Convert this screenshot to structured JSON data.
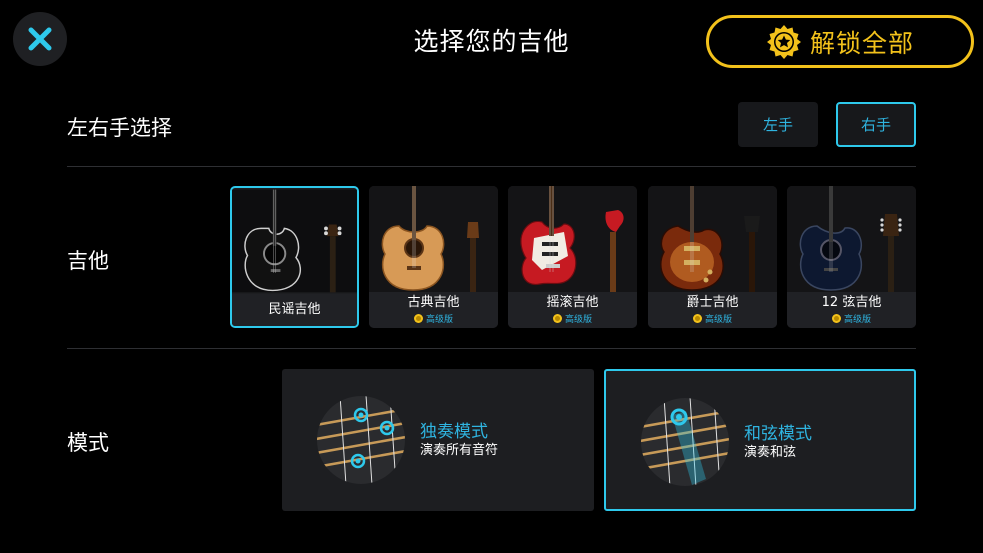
{
  "header": {
    "title": "选择您的吉他",
    "close_icon": "close-icon",
    "unlock_label": "解锁全部",
    "unlock_icon": "star-badge-icon",
    "accent_yellow": "#f3c21b",
    "accent_cyan": "#2ec9ec"
  },
  "handedness": {
    "label": "左右手选择",
    "options": [
      "左手",
      "右手"
    ],
    "selected": "右手"
  },
  "guitars": {
    "label": "吉他",
    "items": [
      {
        "name": "民谣吉他",
        "premium": "",
        "selected": true
      },
      {
        "name": "古典吉他",
        "premium": "高级版",
        "selected": false
      },
      {
        "name": "摇滚吉他",
        "premium": "高级版",
        "selected": false
      },
      {
        "name": "爵士吉他",
        "premium": "高级版",
        "selected": false
      },
      {
        "name": "12 弦吉他",
        "premium": "高级版",
        "selected": false
      }
    ]
  },
  "mode": {
    "label": "模式",
    "items": [
      {
        "title": "独奏模式",
        "subtitle": "演奏所有音符",
        "selected": false
      },
      {
        "title": "和弦模式",
        "subtitle": "演奏和弦",
        "selected": true
      }
    ]
  }
}
